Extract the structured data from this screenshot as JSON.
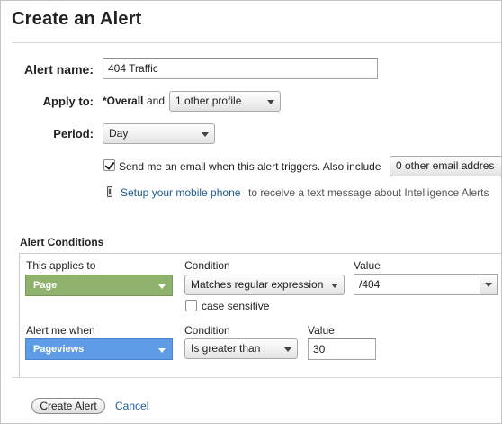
{
  "title": "Create an Alert",
  "alert_name": {
    "label": "Alert name:",
    "value": "404 Traffic"
  },
  "apply_to": {
    "label": "Apply to:",
    "overall": "*Overall",
    "and": "and",
    "profile_select": "1 other profile"
  },
  "period": {
    "label": "Period:",
    "value": "Day"
  },
  "email": {
    "checked": true,
    "text": "Send me an email when this alert triggers. Also include",
    "other_select": "0 other email addres"
  },
  "mobile": {
    "icon": "mobile-phone-icon",
    "link": "Setup your mobile phone",
    "text": "to receive a text message about Intelligence Alerts"
  },
  "conditions": {
    "title": "Alert Conditions",
    "row1": {
      "applies_label": "This applies to",
      "applies_value": "Page",
      "applies_color": "#8fb26c",
      "condition_label": "Condition",
      "condition_value": "Matches regular expression",
      "value_label": "Value",
      "value": "/404",
      "case_sensitive_label": "case sensitive",
      "case_sensitive_checked": false
    },
    "row2": {
      "alert_label": "Alert me when",
      "alert_value": "Pageviews",
      "alert_color": "#5f9ce8",
      "condition_label": "Condition",
      "condition_value": "Is greater than",
      "value_label": "Value",
      "value": "30"
    }
  },
  "actions": {
    "create": "Create Alert",
    "cancel": "Cancel"
  }
}
